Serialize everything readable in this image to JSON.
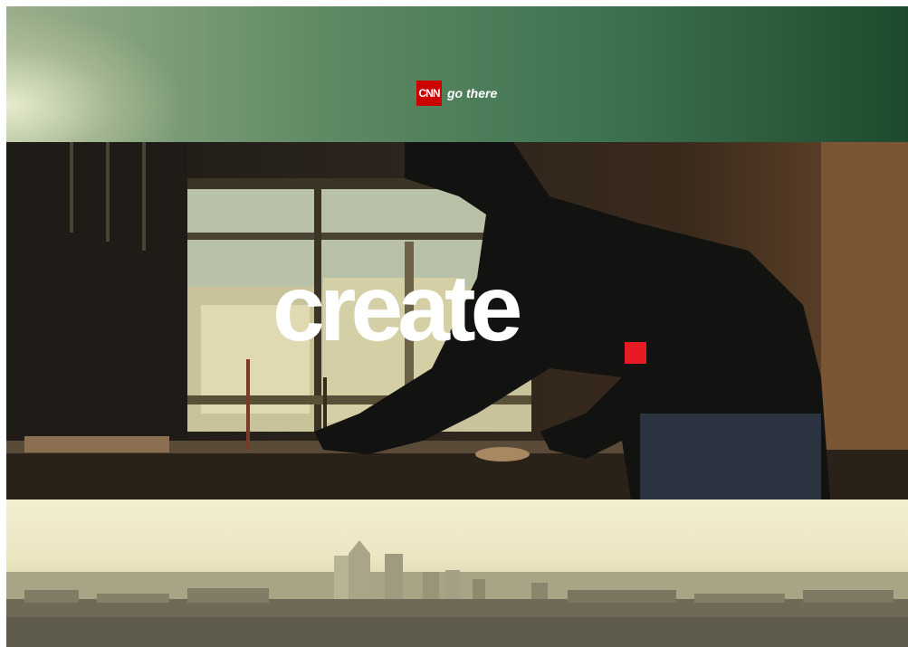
{
  "brand": {
    "logo_text": "CNN",
    "tagline": "go there"
  },
  "headline": {
    "word": "create",
    "accent_color": "#e61b23"
  },
  "colors": {
    "logo_red": "#cc0000",
    "band_green": "#3f7452"
  },
  "scenes": {
    "top": "green-gradient-band",
    "middle": "person-drawing-at-desk-silhouette",
    "bottom": "city-skyline-hazy"
  }
}
